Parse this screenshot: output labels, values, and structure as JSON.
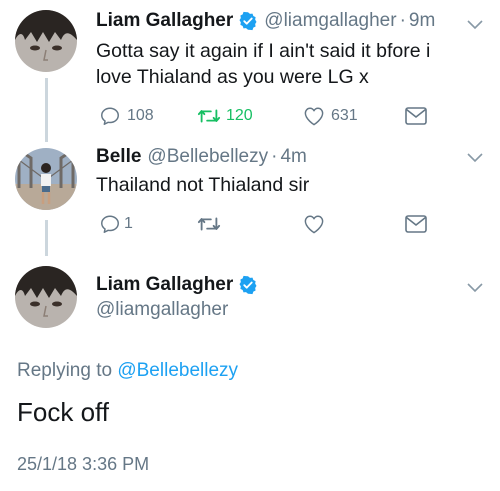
{
  "tweet1": {
    "name": "Liam Gallagher",
    "handle": "@liamgallagher",
    "separator": "·",
    "time": "9m",
    "line1": "Gotta say it again if I ain't said it bfore i",
    "line2": "love Thialand as you were LG x",
    "reply_count": "108",
    "retweet_count": "120",
    "like_count": "631"
  },
  "tweet2": {
    "name": "Belle",
    "handle": "@Bellebellezy",
    "separator": "·",
    "time": "4m",
    "text": "Thailand not Thialand sir",
    "reply_count": "1"
  },
  "main_tweet": {
    "name": "Liam Gallagher",
    "handle": "@liamgallagher",
    "replying_prefix": "Replying to",
    "replying_to": "@Bellebellezy",
    "text": "Fock off",
    "timestamp": "25/1/18 3:36 PM"
  },
  "colors": {
    "verified": "#1da1f2",
    "retweet_active": "#17bf63",
    "link": "#1da1f2",
    "secondary": "#657786"
  },
  "icons": [
    "verified-badge-icon",
    "caret-down-icon",
    "reply-icon",
    "retweet-icon",
    "like-icon",
    "direct-message-icon"
  ]
}
